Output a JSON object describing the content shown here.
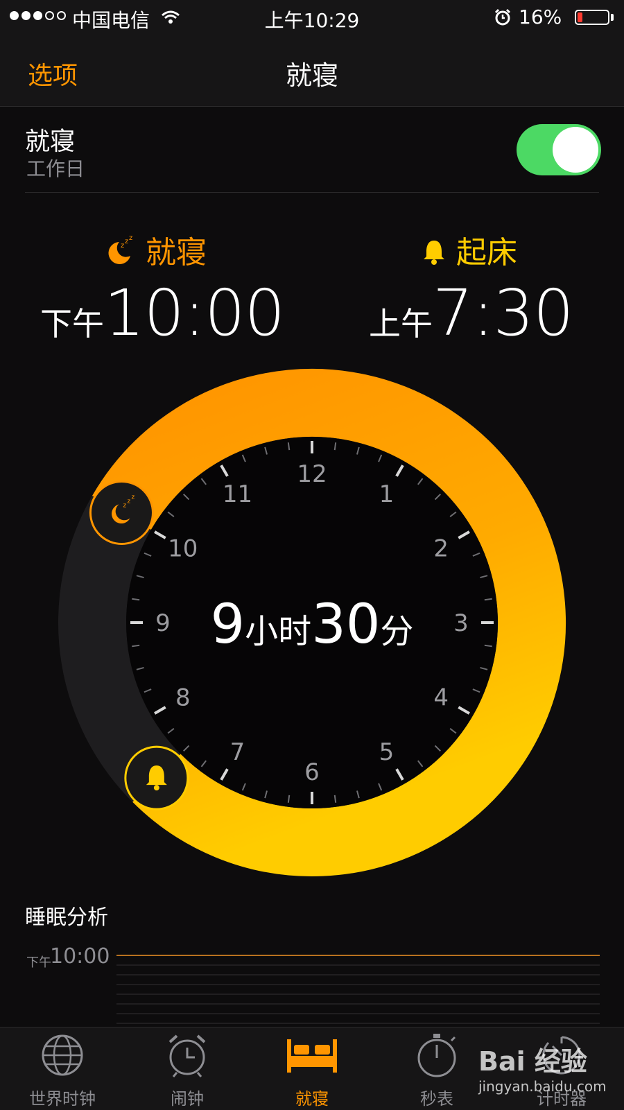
{
  "status_bar": {
    "carrier": "中国电信",
    "time": "上午10:29",
    "battery_percent": "16%",
    "battery_level": 0.16
  },
  "nav": {
    "left_button": "选项",
    "title": "就寝"
  },
  "bedtime_toggle": {
    "title": "就寝",
    "subtitle": "工作日",
    "enabled": true
  },
  "schedule": {
    "bedtime": {
      "label": "就寝",
      "ampm": "下午",
      "time": "10:00"
    },
    "wake": {
      "label": "起床",
      "ampm": "上午",
      "time": "7:30"
    }
  },
  "clock": {
    "hour_labels": [
      "12",
      "1",
      "2",
      "3",
      "4",
      "5",
      "6",
      "7",
      "8",
      "9",
      "10",
      "11"
    ],
    "duration_hours": "9",
    "duration_hours_unit": "小时",
    "duration_minutes": "30",
    "duration_minutes_unit": "分"
  },
  "sleep_analysis": {
    "title": "睡眠分析",
    "ampm": "下午",
    "time": "10:00"
  },
  "tabs": [
    {
      "label": "世界时钟",
      "icon": "globe-icon",
      "active": false
    },
    {
      "label": "闹钟",
      "icon": "alarm-clock-icon",
      "active": false
    },
    {
      "label": "就寝",
      "icon": "bed-icon",
      "active": true
    },
    {
      "label": "秒表",
      "icon": "stopwatch-icon",
      "active": false
    },
    {
      "label": "计时器",
      "icon": "timer-icon",
      "active": false
    }
  ],
  "watermark": {
    "brand": "Bai 经验",
    "url": "jingyan.baidu.com"
  },
  "colors": {
    "accent": "#ff9500",
    "wake": "#ffcc00",
    "switch_on": "#4cd964",
    "background": "#0d0c0d"
  }
}
